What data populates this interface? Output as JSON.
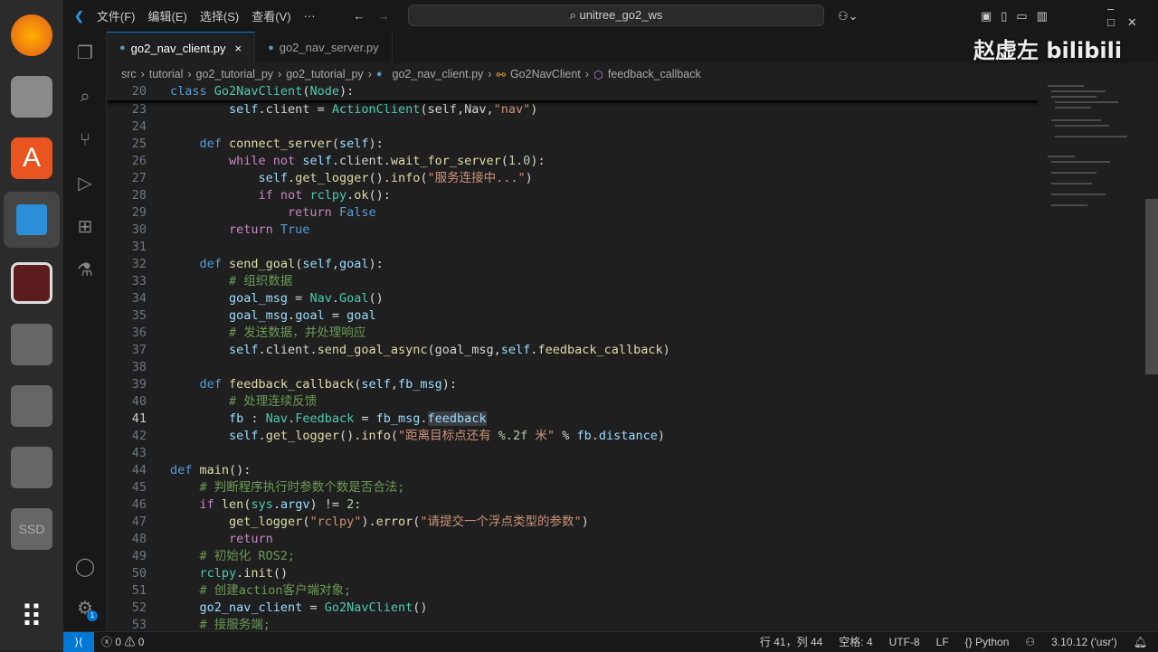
{
  "title": {
    "menus": [
      "文件(F)",
      "编辑(E)",
      "选择(S)",
      "查看(V)",
      "···"
    ],
    "search": "unitree_go2_ws"
  },
  "tabs": [
    {
      "label": "go2_nav_client.py",
      "close": "×"
    },
    {
      "label": "go2_nav_server.py"
    }
  ],
  "breadcrumb": [
    "src",
    "tutorial",
    "go2_tutorial_py",
    "go2_tutorial_py",
    "go2_nav_client.py",
    "Go2NavClient",
    "feedback_callback"
  ],
  "watermark": "赵虚左 bilibili",
  "code": [
    {
      "n": "20",
      "t": [
        [
          "class ",
          "kw"
        ],
        [
          "Go2NavClient",
          "cl"
        ],
        [
          "(",
          "df"
        ],
        [
          "Node",
          "cl"
        ],
        [
          "):",
          "df"
        ]
      ]
    },
    {
      "n": "23",
      "t": [
        [
          "        self",
          "va"
        ],
        [
          ".client = ",
          "df"
        ],
        [
          "ActionClient",
          "cl"
        ],
        [
          "(self,Nav,",
          "df"
        ],
        [
          "\"nav\"",
          "st"
        ],
        [
          ")",
          "df"
        ]
      ]
    },
    {
      "n": "24",
      "t": []
    },
    {
      "n": "25",
      "t": [
        [
          "    def ",
          "kw"
        ],
        [
          "connect_server",
          "fn"
        ],
        [
          "(",
          "df"
        ],
        [
          "self",
          "va"
        ],
        [
          "):",
          "df"
        ]
      ]
    },
    {
      "n": "26",
      "t": [
        [
          "        while not ",
          "ct"
        ],
        [
          "self",
          "va"
        ],
        [
          ".client.",
          "df"
        ],
        [
          "wait_for_server",
          "fn"
        ],
        [
          "(",
          "df"
        ],
        [
          "1.0",
          "nu"
        ],
        [
          "):",
          "df"
        ]
      ]
    },
    {
      "n": "27",
      "t": [
        [
          "            self",
          "va"
        ],
        [
          ".",
          "df"
        ],
        [
          "get_logger",
          "fn"
        ],
        [
          "().",
          "df"
        ],
        [
          "info",
          "fn"
        ],
        [
          "(",
          "df"
        ],
        [
          "\"服务连接中...\"",
          "st"
        ],
        [
          ")",
          "df"
        ]
      ]
    },
    {
      "n": "28",
      "t": [
        [
          "            if not ",
          "ct"
        ],
        [
          "rclpy",
          "cl"
        ],
        [
          ".",
          "df"
        ],
        [
          "ok",
          "fn"
        ],
        [
          "():",
          "df"
        ]
      ]
    },
    {
      "n": "29",
      "t": [
        [
          "                return ",
          "ct"
        ],
        [
          "False",
          "kw"
        ]
      ]
    },
    {
      "n": "30",
      "t": [
        [
          "        return ",
          "ct"
        ],
        [
          "True",
          "kw"
        ]
      ]
    },
    {
      "n": "31",
      "t": []
    },
    {
      "n": "32",
      "t": [
        [
          "    def ",
          "kw"
        ],
        [
          "send_goal",
          "fn"
        ],
        [
          "(",
          "df"
        ],
        [
          "self",
          "va"
        ],
        [
          ",",
          "df"
        ],
        [
          "goal",
          "va"
        ],
        [
          "):",
          "df"
        ]
      ]
    },
    {
      "n": "33",
      "t": [
        [
          "        # 组织数据",
          "cm"
        ]
      ]
    },
    {
      "n": "34",
      "t": [
        [
          "        goal_msg",
          "va"
        ],
        [
          " = ",
          "df"
        ],
        [
          "Nav",
          "cl"
        ],
        [
          ".",
          "df"
        ],
        [
          "Goal",
          "cl"
        ],
        [
          "()",
          "df"
        ]
      ]
    },
    {
      "n": "35",
      "t": [
        [
          "        goal_msg",
          "va"
        ],
        [
          ".",
          "df"
        ],
        [
          "goal",
          "va"
        ],
        [
          " = ",
          "df"
        ],
        [
          "goal",
          "va"
        ]
      ]
    },
    {
      "n": "36",
      "t": [
        [
          "        # 发送数据，并处理响应",
          "cm"
        ]
      ]
    },
    {
      "n": "37",
      "t": [
        [
          "        self",
          "va"
        ],
        [
          ".client.",
          "df"
        ],
        [
          "send_goal_async",
          "fn"
        ],
        [
          "(goal_msg,",
          "df"
        ],
        [
          "self",
          "va"
        ],
        [
          ".",
          "df"
        ],
        [
          "feedback_callback",
          "fn"
        ],
        [
          ")",
          "df"
        ]
      ]
    },
    {
      "n": "38",
      "t": []
    },
    {
      "n": "39",
      "t": [
        [
          "    def ",
          "kw"
        ],
        [
          "feedback_callback",
          "fn"
        ],
        [
          "(",
          "df"
        ],
        [
          "self",
          "va"
        ],
        [
          ",",
          "df"
        ],
        [
          "fb_msg",
          "va"
        ],
        [
          "):",
          "df"
        ]
      ]
    },
    {
      "n": "40",
      "t": [
        [
          "        # 处理连续反馈",
          "cm"
        ]
      ]
    },
    {
      "n": "41",
      "t": [
        [
          "        fb",
          "va"
        ],
        [
          " : ",
          "df"
        ],
        [
          "Nav",
          "cl"
        ],
        [
          ".",
          "df"
        ],
        [
          "Feedback",
          "cl"
        ],
        [
          " = ",
          "df"
        ],
        [
          "fb_msg",
          "va"
        ],
        [
          ".",
          "df"
        ],
        [
          "feedback",
          "sel va"
        ]
      ],
      "cur": true
    },
    {
      "n": "42",
      "t": [
        [
          "        self",
          "va"
        ],
        [
          ".",
          "df"
        ],
        [
          "get_logger",
          "fn"
        ],
        [
          "().",
          "df"
        ],
        [
          "info",
          "fn"
        ],
        [
          "(",
          "df"
        ],
        [
          "\"距离目标点还有 ",
          "st"
        ],
        [
          "%.2f",
          "nu"
        ],
        [
          " 米\"",
          "st"
        ],
        [
          " % ",
          "df"
        ],
        [
          "fb",
          "va"
        ],
        [
          ".",
          "df"
        ],
        [
          "distance",
          "va"
        ],
        [
          ")",
          "df"
        ]
      ]
    },
    {
      "n": "43",
      "t": []
    },
    {
      "n": "44",
      "t": [
        [
          "def ",
          "kw"
        ],
        [
          "main",
          "fn"
        ],
        [
          "():",
          "df"
        ]
      ]
    },
    {
      "n": "45",
      "t": [
        [
          "    # 判断程序执行时参数个数是否合法;",
          "cm"
        ]
      ]
    },
    {
      "n": "46",
      "t": [
        [
          "    if ",
          "ct"
        ],
        [
          "len",
          "fn"
        ],
        [
          "(",
          "df"
        ],
        [
          "sys",
          "cl"
        ],
        [
          ".",
          "df"
        ],
        [
          "argv",
          "va"
        ],
        [
          ") != ",
          "df"
        ],
        [
          "2",
          "nu"
        ],
        [
          ":",
          "df"
        ]
      ]
    },
    {
      "n": "47",
      "t": [
        [
          "        get_logger",
          "fn"
        ],
        [
          "(",
          "df"
        ],
        [
          "\"rclpy\"",
          "st"
        ],
        [
          ").",
          "df"
        ],
        [
          "error",
          "fn"
        ],
        [
          "(",
          "df"
        ],
        [
          "\"请提交一个浮点类型的参数\"",
          "st"
        ],
        [
          ")",
          "df"
        ]
      ]
    },
    {
      "n": "48",
      "t": [
        [
          "        return",
          "ct"
        ]
      ]
    },
    {
      "n": "49",
      "t": [
        [
          "    # 初始化 ROS2;",
          "cm"
        ]
      ]
    },
    {
      "n": "50",
      "t": [
        [
          "    rclpy",
          "cl"
        ],
        [
          ".",
          "df"
        ],
        [
          "init",
          "fn"
        ],
        [
          "()",
          "df"
        ]
      ]
    },
    {
      "n": "51",
      "t": [
        [
          "    # 创建action客户端对象;",
          "cm"
        ]
      ]
    },
    {
      "n": "52",
      "t": [
        [
          "    go2_nav_client",
          "va"
        ],
        [
          " = ",
          "df"
        ],
        [
          "Go2NavClient",
          "cl"
        ],
        [
          "()",
          "df"
        ]
      ]
    },
    {
      "n": "53",
      "t": [
        [
          "    # 接服务端;",
          "cm"
        ]
      ]
    }
  ],
  "status": {
    "errors": "0",
    "warnings": "0",
    "position": "行 41，列 44",
    "indent": "空格: 4",
    "encoding": "UTF-8",
    "eol": "LF",
    "language": "Python",
    "interpreter": "3.10.12 ('usr')"
  },
  "dock": {
    "ssd": "SSD",
    "badge": "1"
  }
}
